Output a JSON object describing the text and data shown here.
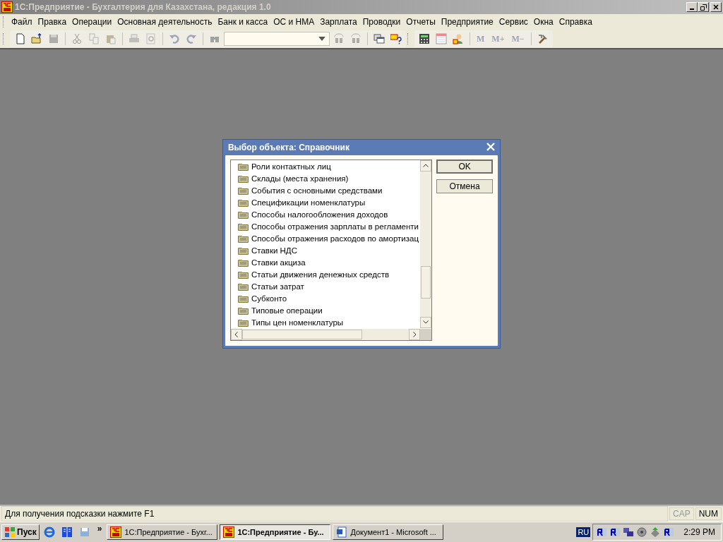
{
  "window": {
    "title": "1С:Предприятие - Бухгалтерия для Казахстана, редакция 1.0",
    "active": false
  },
  "menu": [
    {
      "label": "Файл"
    },
    {
      "label": "Правка"
    },
    {
      "label": "Операции"
    },
    {
      "label": "Основная деятельность"
    },
    {
      "label": "Банк и касса"
    },
    {
      "label": "ОС и НМА"
    },
    {
      "label": "Зарплата"
    },
    {
      "label": "Проводки"
    },
    {
      "label": "Отчеты"
    },
    {
      "label": "Предприятие"
    },
    {
      "label": "Сервис"
    },
    {
      "label": "Окна"
    },
    {
      "label": "Справка"
    }
  ],
  "toolbars": [
    [
      {
        "kind": "new",
        "disabled": false
      },
      {
        "kind": "open",
        "disabled": false
      },
      {
        "kind": "save",
        "disabled": true
      },
      {
        "kind": "sep"
      },
      {
        "kind": "cut",
        "disabled": true
      },
      {
        "kind": "copy",
        "disabled": true
      },
      {
        "kind": "paste",
        "disabled": true
      },
      {
        "kind": "sep"
      },
      {
        "kind": "print",
        "disabled": true
      },
      {
        "kind": "preview",
        "disabled": true
      },
      {
        "kind": "sep"
      },
      {
        "kind": "undo",
        "disabled": true
      },
      {
        "kind": "redo",
        "disabled": true
      },
      {
        "kind": "sep"
      },
      {
        "kind": "find",
        "disabled": true
      },
      {
        "kind": "combo"
      },
      {
        "kind": "findprev",
        "disabled": true
      },
      {
        "kind": "findnext",
        "disabled": true
      },
      {
        "kind": "sep"
      },
      {
        "kind": "windows",
        "disabled": false
      },
      {
        "kind": "help",
        "disabled": false
      }
    ],
    [
      {
        "kind": "calc",
        "disabled": false
      },
      {
        "kind": "calendar",
        "disabled": false
      },
      {
        "kind": "user",
        "disabled": false
      },
      {
        "kind": "sep"
      },
      {
        "kind": "text",
        "label": "M",
        "disabled": true
      },
      {
        "kind": "text",
        "label": "M+",
        "disabled": true
      },
      {
        "kind": "text",
        "label": "M−",
        "disabled": true
      },
      {
        "kind": "sep"
      },
      {
        "kind": "tools",
        "disabled": false
      }
    ]
  ],
  "dialog": {
    "title": "Выбор объекта: Справочник",
    "items": [
      {
        "label": "Роли контактных лиц",
        "selected": false
      },
      {
        "label": "Склады (места хранения)",
        "selected": false
      },
      {
        "label": "События с основными средствами",
        "selected": false
      },
      {
        "label": "Спецификации номенклатуры",
        "selected": false
      },
      {
        "label": "Способы налогообложения доходов",
        "selected": false
      },
      {
        "label": "Способы отражения зарплаты в регламенти",
        "selected": false
      },
      {
        "label": "Способы отражения расходов по амортизац",
        "selected": false
      },
      {
        "label": "Ставки НДС",
        "selected": false
      },
      {
        "label": "Ставки акциза",
        "selected": false
      },
      {
        "label": "Статьи движения денежных средств",
        "selected": false
      },
      {
        "label": "Статьи затрат",
        "selected": false
      },
      {
        "label": "Субконто",
        "selected": false
      },
      {
        "label": "Типовые операции",
        "selected": false
      },
      {
        "label": "Типы цен номенклатуры",
        "selected": false
      }
    ],
    "buttons": [
      {
        "label": "OK",
        "default": true
      },
      {
        "label": "Отмена",
        "default": false
      }
    ]
  },
  "status_bar": {
    "hint": "Для получения подсказки нажмите F1",
    "indicators": [
      {
        "label": "CAP",
        "on": false
      },
      {
        "label": "NUM",
        "on": true
      }
    ]
  },
  "taskbar": {
    "start": "Пуск",
    "overflow": "»",
    "tasks": [
      {
        "label": "1С:Предприятие - Бухг...",
        "kind": "onec",
        "selected": false
      },
      {
        "label": "1С:Предприятие - Бу...",
        "kind": "onec",
        "selected": true
      },
      {
        "label": "Документ1 - Microsoft ...",
        "kind": "word",
        "selected": false
      }
    ],
    "language": "RU",
    "clock": "2:29 PM"
  }
}
